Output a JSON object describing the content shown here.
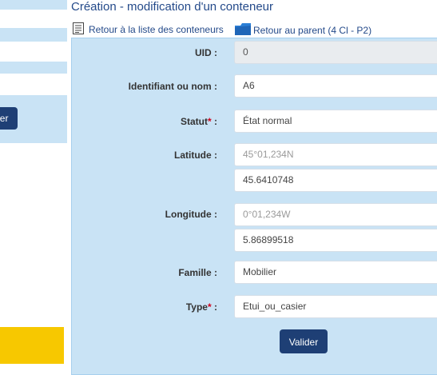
{
  "left_panel": {
    "button_label": "Valider"
  },
  "page": {
    "title": "Création - modification d'un conteneur"
  },
  "links": {
    "back_to_list": "Retour à la liste des conteneurs",
    "back_to_parent": "Retour au parent (4 Cl - P2)"
  },
  "form": {
    "uid_label": "UID :",
    "uid_value": "0",
    "identifier_label": "Identifiant ou nom :",
    "identifier_value": "A6",
    "status_label": "Statut",
    "status_required": "*",
    "status_colon": " :",
    "status_value": "État normal",
    "latitude_label": "Latitude :",
    "latitude_placeholder": "45°01,234N",
    "latitude_value": "45.6410748",
    "longitude_label": "Longitude :",
    "longitude_placeholder": "0°01,234W",
    "longitude_value": "5.86899518",
    "family_label": "Famille :",
    "family_value": "Mobilier",
    "type_label": "Type",
    "type_required": "*",
    "type_colon": " :",
    "type_value": "Etui_ou_casier",
    "submit_label": "Valider"
  },
  "colors": {
    "panel_bg": "#c9e3f5",
    "button_bg": "#1e3f75",
    "link": "#244a8a",
    "required": "#d0021b",
    "yellow": "#f7c800"
  }
}
